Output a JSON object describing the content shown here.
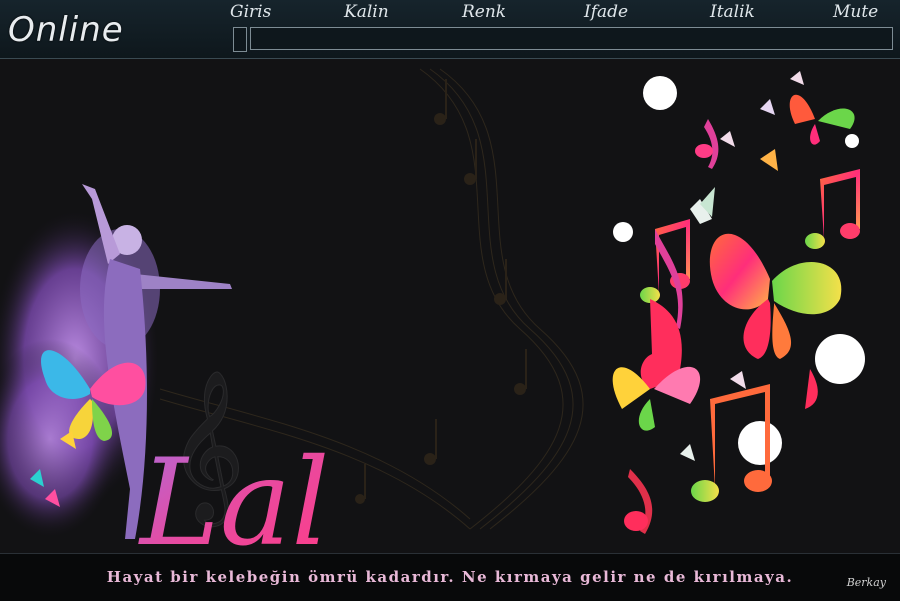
{
  "header": {
    "logo": "Online",
    "menu": [
      "Giris",
      "Kalin",
      "Renk",
      "Ifade",
      "Italik",
      "Mute"
    ],
    "message_input": {
      "value": "",
      "placeholder": ""
    }
  },
  "artwork": {
    "title": "Lal",
    "icons": [
      "ballerina-silhouette",
      "butterflies",
      "music-notes",
      "treble-clef"
    ]
  },
  "footer": {
    "quote": "Hayat bir kelebeğin ömrü kadardır. Ne kırmaya gelir ne de kırılmaya.",
    "signature": "Berkay"
  },
  "colors": {
    "background": "#121214",
    "topbar": "#16242c",
    "quote": "#e9b9d8",
    "accent_pink": "#e0409a"
  }
}
